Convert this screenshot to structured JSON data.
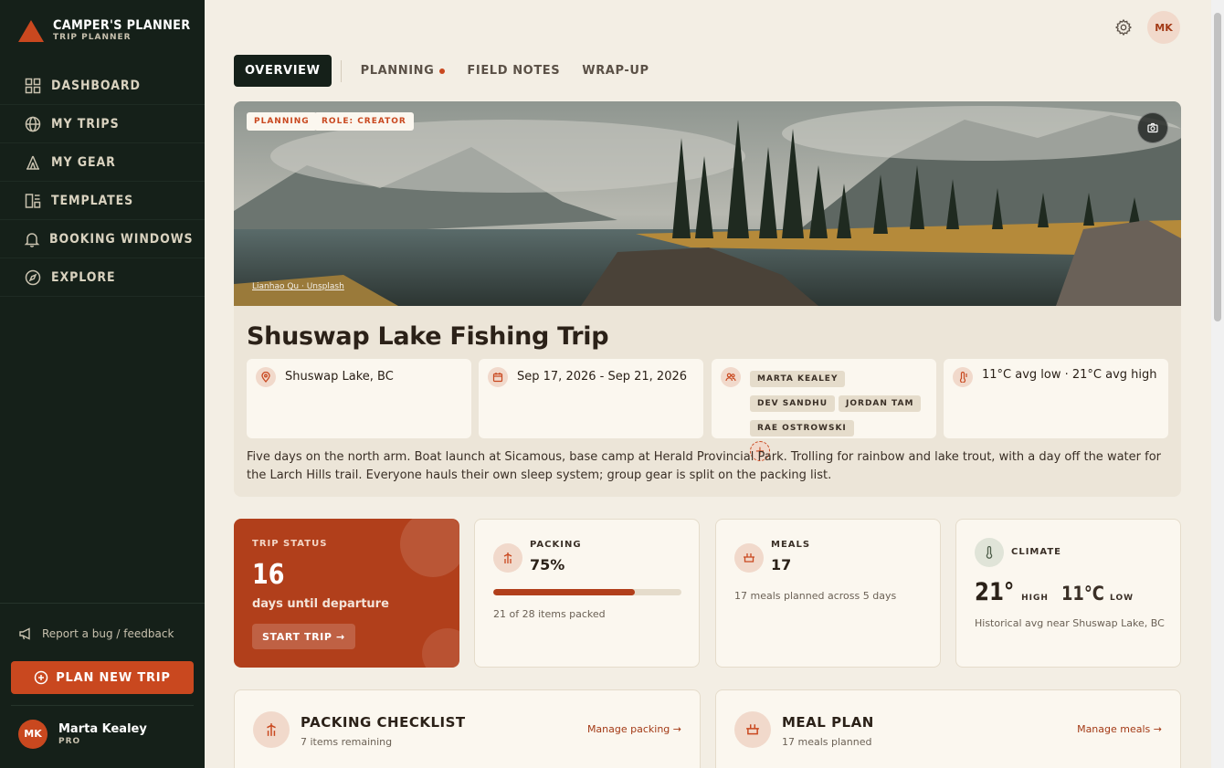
{
  "brand": {
    "title": "CAMPER'S PLANNER",
    "subtitle": "TRIP PLANNER"
  },
  "sidebar": {
    "items": [
      {
        "label": "DASHBOARD",
        "icon": "grid-icon"
      },
      {
        "label": "MY TRIPS",
        "icon": "globe-icon"
      },
      {
        "label": "MY GEAR",
        "icon": "tent-icon"
      },
      {
        "label": "TEMPLATES",
        "icon": "template-icon"
      },
      {
        "label": "BOOKING WINDOWS",
        "icon": "bell-icon"
      },
      {
        "label": "EXPLORE",
        "icon": "compass-icon"
      }
    ],
    "report_label": "Report a bug / feedback",
    "plan_button": "PLAN NEW TRIP",
    "user": {
      "initials": "MK",
      "name": "Marta Kealey",
      "tier": "PRO"
    }
  },
  "header": {
    "avatar_initials": "MK"
  },
  "tabs": [
    {
      "label": "OVERVIEW",
      "active": true
    },
    {
      "label": "PLANNING",
      "active": false,
      "dot": true
    },
    {
      "label": "FIELD NOTES",
      "active": false
    },
    {
      "label": "WRAP-UP",
      "active": false
    }
  ],
  "hero": {
    "badges": [
      "PLANNING",
      "ROLE: CREATOR"
    ],
    "photo_credit": "Lianhao Qu · Unsplash",
    "title": "Shuswap Lake Fishing Trip",
    "location": "Shuswap Lake, BC",
    "dates": "Sep 17, 2026 - Sep 21, 2026",
    "members": [
      "MARTA KEALEY",
      "DEV SANDHU",
      "JORDAN TAM",
      "RAE OSTROWSKI"
    ],
    "add_member": "+",
    "weather": "11°C avg low · 21°C avg high",
    "description": "Five days on the north arm. Boat launch at Sicamous, base camp at Herald Provincial Park. Trolling for rainbow and lake trout, with a day off the water for the Larch Hills trail. Everyone hauls their own sleep system; group gear is split on the packing list."
  },
  "stats": {
    "status": {
      "label": "TRIP STATUS",
      "value": "16",
      "caption": "days until departure",
      "button": "START TRIP →"
    },
    "packing": {
      "label": "PACKING",
      "value": "75%",
      "progress": 0.75,
      "caption": "21 of 28 items packed"
    },
    "meals": {
      "label": "MEALS",
      "value": "17",
      "caption": "17 meals planned across 5 days"
    },
    "climate": {
      "label": "CLIMATE",
      "high": "21°",
      "high_label": "HIGH",
      "low": "11°C",
      "low_label": "LOW",
      "caption": "Historical avg near Shuswap Lake, BC"
    }
  },
  "sections": {
    "packing": {
      "title": "PACKING CHECKLIST",
      "subtitle": "7 items remaining",
      "link": "Manage packing →"
    },
    "meals": {
      "title": "MEAL PLAN",
      "subtitle": "17 meals planned",
      "link": "Manage meals →"
    }
  },
  "colors": {
    "accent": "#c9481f",
    "sidebar": "#152019",
    "background": "#f3eee4",
    "card": "#fbf7ef"
  }
}
